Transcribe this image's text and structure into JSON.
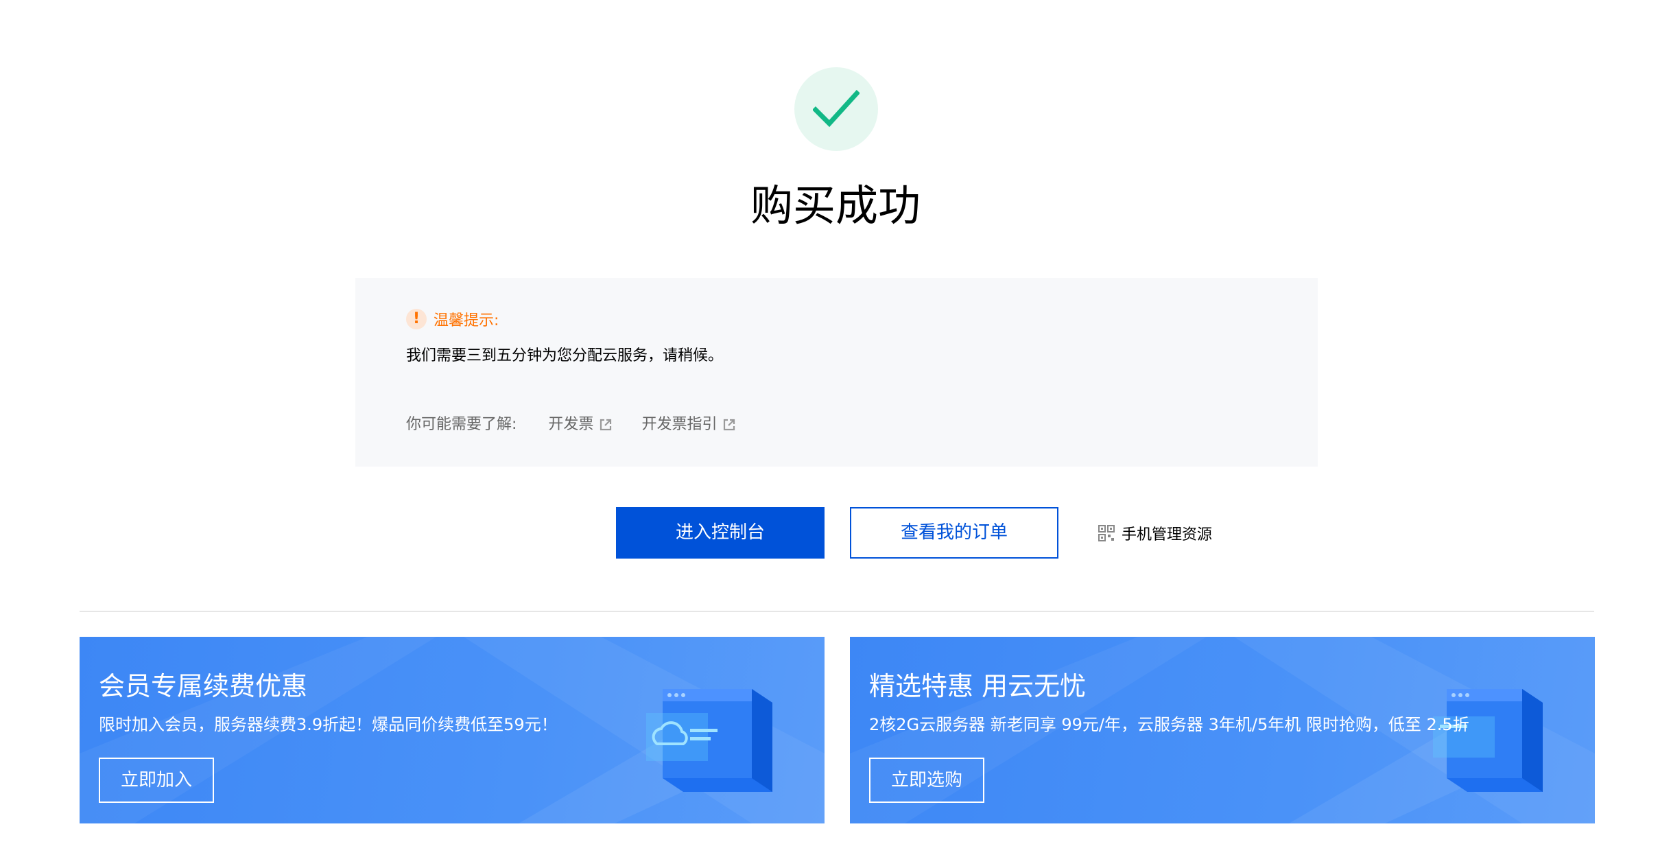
{
  "success": {
    "icon": "checkmark-icon",
    "title": "购买成功",
    "accent_color": "#07c160"
  },
  "notice": {
    "icon": "warning-icon",
    "title": "温馨提示:",
    "message": "我们需要三到五分钟为您分配云服务，请稍候。",
    "links_label": "你可能需要了解:",
    "links": [
      {
        "label": "开发票",
        "icon": "external-link-icon"
      },
      {
        "label": "开发票指引",
        "icon": "external-link-icon"
      }
    ]
  },
  "actions": {
    "console_button": "进入控制台",
    "orders_button": "查看我的订单",
    "mobile_manage": "手机管理资源",
    "mobile_icon": "qrcode-icon",
    "primary_color": "#0052d9"
  },
  "banners": [
    {
      "title": "会员专属续费优惠",
      "description": "限时加入会员，服务器续费3.9折起！爆品同价续费低至59元！",
      "button": "立即加入",
      "illustration": "cloud-window-icon"
    },
    {
      "title": "精选特惠 用云无忧",
      "description": "2核2G云服务器 新老同享 99元/年，云服务器 3年机/5年机 限时抢购，低至 2.5折",
      "button": "立即选购",
      "illustration": "browser-window-icon"
    }
  ]
}
